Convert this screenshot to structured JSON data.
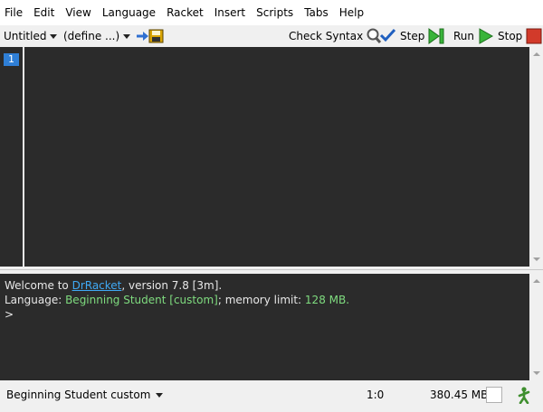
{
  "menu": [
    "File",
    "Edit",
    "View",
    "Language",
    "Racket",
    "Insert",
    "Scripts",
    "Tabs",
    "Help"
  ],
  "toolbar": {
    "file_name": "Untitled",
    "define_menu": "(define ...)",
    "check_syntax": "Check Syntax",
    "step": "Step",
    "run": "Run",
    "stop": "Stop"
  },
  "editor": {
    "line_numbers": [
      "1"
    ]
  },
  "interactions": {
    "welcome_prefix": "Welcome to ",
    "app_link": "DrRacket",
    "welcome_suffix": ", version 7.8 [3m].",
    "language_prefix": "Language: ",
    "language_value": "Beginning Student [custom]",
    "memory_prefix": "; memory limit: ",
    "memory_value": "128 MB.",
    "prompt": ">"
  },
  "status": {
    "language": "Beginning Student custom",
    "position": "1:0",
    "memory": "380.45 MB"
  },
  "colors": {
    "editor_bg": "#2b2b2b",
    "line_number_bg": "#2f7fd6",
    "link": "#3fa9f5",
    "language_green": "#7fdc7f"
  },
  "icons": [
    "save-icon",
    "check-syntax-icon",
    "step-icon",
    "run-icon",
    "stop-icon",
    "gc-walker-icon"
  ]
}
